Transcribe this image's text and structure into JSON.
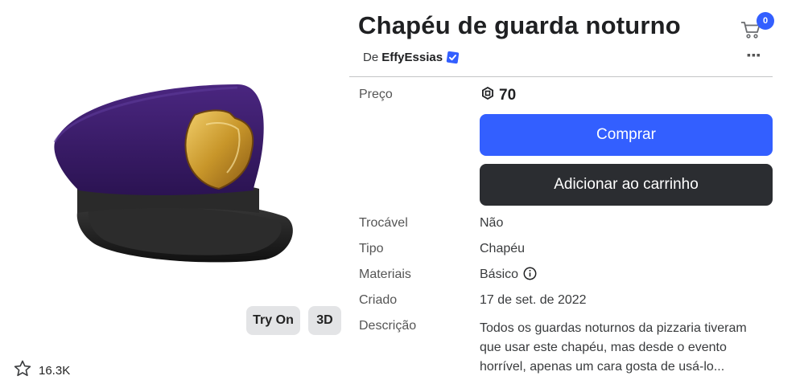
{
  "item": {
    "title": "Chapéu de guarda noturno",
    "creator_prefix": "De",
    "creator_name": "EffyEssias"
  },
  "cart": {
    "count": "0"
  },
  "media_buttons": {
    "try_on": "Try On",
    "three_d": "3D"
  },
  "favorites": {
    "count": "16.3K"
  },
  "price": {
    "label": "Preço",
    "value": "70"
  },
  "actions": {
    "buy": "Comprar",
    "add_to_cart": "Adicionar ao carrinho"
  },
  "details": {
    "tradable_label": "Trocável",
    "tradable_value": "Não",
    "type_label": "Tipo",
    "type_value": "Chapéu",
    "materials_label": "Materiais",
    "materials_value": "Básico",
    "created_label": "Criado",
    "created_value": "17 de set. de 2022",
    "description_label": "Descrição",
    "description_value": "Todos os guardas noturnos da pizzaria tiveram que usar este chapéu, mas desde o evento horrível, apenas um cara gosta de usá-lo..."
  },
  "colors": {
    "primary": "#335fff",
    "dark_button": "#2b2d31",
    "hat": "#3c1f6e",
    "badge": "#c8962a"
  },
  "icons": [
    "star-icon",
    "cart-icon",
    "more-icon",
    "verified-icon",
    "robux-icon",
    "info-icon"
  ]
}
